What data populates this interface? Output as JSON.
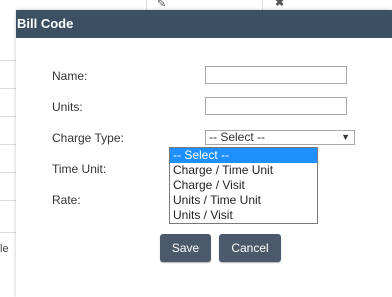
{
  "background": {
    "row_fragment_text": "le"
  },
  "dialog": {
    "title": "Bill Code"
  },
  "form": {
    "name_label": "Name:",
    "name_value": "",
    "units_label": "Units:",
    "units_value": "",
    "charge_type_label": "Charge Type:",
    "charge_type_selected": "-- Select --",
    "time_unit_label": "Time Unit:",
    "rate_label": "Rate:"
  },
  "charge_type_options": [
    "-- Select --",
    "Charge / Time Unit",
    "Charge / Visit",
    "Units / Time Unit",
    "Units / Visit"
  ],
  "buttons": {
    "save_label": "Save",
    "cancel_label": "Cancel"
  },
  "colors": {
    "header_bg": "#3d4f63",
    "button_bg": "#4a5a6b",
    "selected_option_bg": "#1e90ff"
  }
}
